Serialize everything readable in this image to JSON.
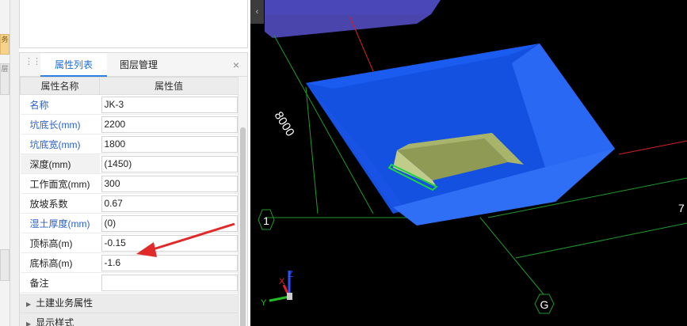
{
  "left_strip": {
    "chip_a": "务",
    "chip_b": "层",
    "chip_c": ""
  },
  "panel": {
    "tabs": [
      {
        "label": "属性列表",
        "active": true
      },
      {
        "label": "图层管理",
        "active": false
      }
    ],
    "close_icon": "×",
    "columns": {
      "name": "属性名称",
      "value": "属性值"
    },
    "rows": [
      {
        "name": "名称",
        "value": "JK-3",
        "blue": true,
        "shaded": false
      },
      {
        "name": "坑底长(mm)",
        "value": "2200",
        "blue": true,
        "shaded": false
      },
      {
        "name": "坑底宽(mm)",
        "value": "1800",
        "blue": true,
        "shaded": false
      },
      {
        "name": "深度(mm)",
        "value": "(1450)",
        "blue": false,
        "shaded": true
      },
      {
        "name": "工作面宽(mm)",
        "value": "300",
        "blue": false,
        "shaded": false
      },
      {
        "name": "放坡系数",
        "value": "0.67",
        "blue": false,
        "shaded": false
      },
      {
        "name": "湿土厚度(mm)",
        "value": "(0)",
        "blue": true,
        "shaded": false
      },
      {
        "name": "顶标高(m)",
        "value": "-0.15",
        "blue": false,
        "shaded": false
      },
      {
        "name": "底标高(m)",
        "value": "-1.6",
        "blue": false,
        "shaded": false
      },
      {
        "name": "备注",
        "value": "",
        "blue": false,
        "shaded": false
      }
    ],
    "groups": [
      "土建业务属性",
      "显示样式"
    ]
  },
  "viewport": {
    "collapse_icon": "‹",
    "dimension_label": "8000",
    "axis_label_1": "1",
    "axis_label_g": "G",
    "axis_label_7": "7",
    "gizmo": {
      "x": "X",
      "y": "Y",
      "z": "Z"
    },
    "colors": {
      "pit": "#1a5cf0",
      "pit_side": "#2a72f5",
      "pad": "#a8b46a",
      "annotation_arrow": "#e02a2a",
      "grid_green": "#1f9a2a"
    }
  }
}
